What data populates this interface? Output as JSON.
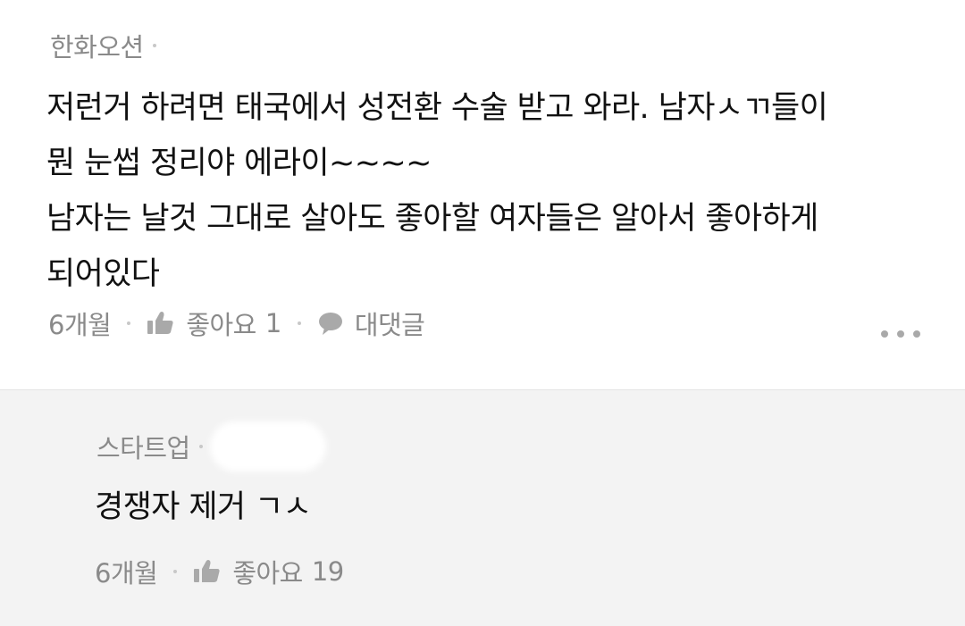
{
  "comment": {
    "author": "한화오션",
    "text_lines": [
      "저런거 하려면 태국에서 성전환 수술 받고 와라. 남자ㅅㄲ들이",
      "뭔 눈썹 정리야 에라이~~~~",
      "남자는 날것 그대로 살아도 좋아할 여자들은 알아서 좋아하게",
      "되어있다"
    ],
    "time": "6개월",
    "like_label": "좋아요",
    "like_count": "1",
    "reply_label": "대댓글"
  },
  "reply": {
    "author": "스타트업",
    "text": "경쟁자 제거 ㄱㅅ",
    "time": "6개월",
    "like_label": "좋아요",
    "like_count": "19"
  },
  "icons": {
    "like": "thumbs-up-icon",
    "reply": "speech-bubble-icon",
    "more": "more-dots-icon"
  },
  "colors": {
    "meta_gray": "#8a8a8a",
    "icon_gray": "#a9a9a9",
    "reply_background": "#f3f3f3",
    "text": "#111111"
  }
}
